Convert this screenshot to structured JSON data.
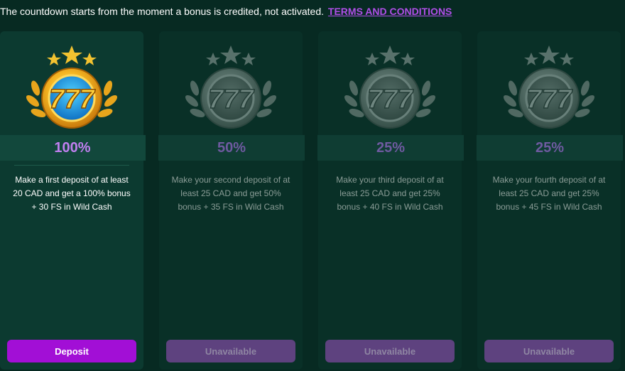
{
  "notice": {
    "text": "The countdown starts from the moment a bonus is credited, not activated.",
    "link_label": "TERMS AND CONDITIONS"
  },
  "colors": {
    "background": "#072a22",
    "accent_purple": "#a20fd6",
    "percent_active": "#c07ff0",
    "percent_inactive": "#6e5aa0",
    "button_disabled": "#5e427f"
  },
  "cards": [
    {
      "percent": "100%",
      "description": "Make a first deposit of at least 20 CAD and get a 100% bonus + 30 FS in Wild Cash",
      "button_label": "Deposit",
      "icon": "golden-777-medal-icon",
      "active": true
    },
    {
      "percent": "50%",
      "description": "Make your second deposit of at least 25 CAD and get 50% bonus + 35 FS in Wild Cash",
      "button_label": "Unavailable",
      "icon": "silver-777-medal-icon",
      "active": false
    },
    {
      "percent": "25%",
      "description": "Make your third deposit of at least 25 CAD and get 25% bonus + 40 FS in Wild Cash",
      "button_label": "Unavailable",
      "icon": "silver-777-medal-icon",
      "active": false
    },
    {
      "percent": "25%",
      "description": "Make your fourth deposit of at least 25 CAD and get 25% bonus + 45 FS in Wild Cash",
      "button_label": "Unavailable",
      "icon": "silver-777-medal-icon",
      "active": false
    }
  ]
}
